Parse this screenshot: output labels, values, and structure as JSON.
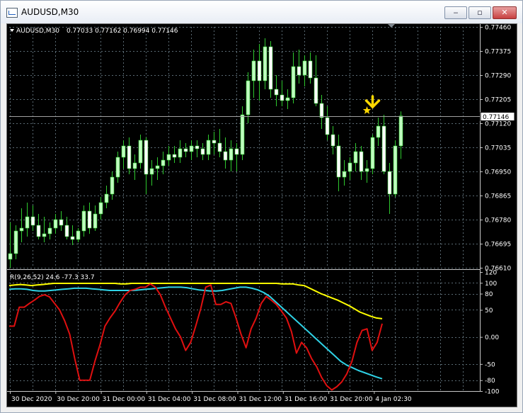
{
  "window": {
    "title": "AUDUSD,M30",
    "min_glyph": "‒",
    "max_glyph": "▫",
    "close_glyph": "✕"
  },
  "main": {
    "header_symbol": "AUDUSD,M30",
    "header_ohlc": "0.77033 0.77162 0.76994 0.77146",
    "current_price": "0.77146",
    "price_ticks": [
      "0.77460",
      "0.77375",
      "0.77290",
      "0.77205",
      "0.77120",
      "0.77035",
      "0.76950",
      "0.76865",
      "0.76780",
      "0.76695",
      "0.76610"
    ],
    "time_ticks": [
      "30 Dec 2020",
      "30 Dec 20:00",
      "31 Dec 00:00",
      "31 Dec 04:00",
      "31 Dec 08:00",
      "31 Dec 12:00",
      "31 Dec 16:00",
      "31 Dec 20:00",
      "4 Jan 02:30"
    ]
  },
  "indicator": {
    "label": "R(9,26,52) 24.6 -77.3 33.7",
    "ticks": [
      "120",
      "100",
      "80",
      "50",
      "0.00",
      "-50",
      "-80",
      "-100"
    ]
  },
  "colors": {
    "background": "#000000",
    "grid": "#5a6a73",
    "bull": "#bfffbf",
    "bear": "#ffffff",
    "wick": "#2ec82e",
    "line_yellow": "#ffff00",
    "line_cyan": "#2fd2e6",
    "line_red": "#e01010",
    "marker": "#ffd800"
  },
  "chart_data": {
    "type": "candlestick",
    "symbol": "AUDUSD",
    "timeframe": "M30",
    "price_range": [
      0.7661,
      0.7746
    ],
    "candles": [
      {
        "o": 0.7664,
        "h": 0.7677,
        "l": 0.7661,
        "c": 0.7666
      },
      {
        "o": 0.7666,
        "h": 0.7676,
        "l": 0.7664,
        "c": 0.7674
      },
      {
        "o": 0.7674,
        "h": 0.7682,
        "l": 0.767,
        "c": 0.7675
      },
      {
        "o": 0.7675,
        "h": 0.7684,
        "l": 0.7672,
        "c": 0.7679
      },
      {
        "o": 0.7679,
        "h": 0.7683,
        "l": 0.7674,
        "c": 0.7676
      },
      {
        "o": 0.7676,
        "h": 0.768,
        "l": 0.7671,
        "c": 0.7672
      },
      {
        "o": 0.7672,
        "h": 0.7679,
        "l": 0.767,
        "c": 0.7673
      },
      {
        "o": 0.7673,
        "h": 0.7677,
        "l": 0.7671,
        "c": 0.7675
      },
      {
        "o": 0.7675,
        "h": 0.768,
        "l": 0.7673,
        "c": 0.7678
      },
      {
        "o": 0.7678,
        "h": 0.7681,
        "l": 0.7674,
        "c": 0.7676
      },
      {
        "o": 0.7676,
        "h": 0.7679,
        "l": 0.7671,
        "c": 0.7672
      },
      {
        "o": 0.7672,
        "h": 0.7676,
        "l": 0.7669,
        "c": 0.7671
      },
      {
        "o": 0.7671,
        "h": 0.7675,
        "l": 0.767,
        "c": 0.7674
      },
      {
        "o": 0.7674,
        "h": 0.7683,
        "l": 0.7672,
        "c": 0.7681
      },
      {
        "o": 0.7681,
        "h": 0.7684,
        "l": 0.7673,
        "c": 0.7675
      },
      {
        "o": 0.7675,
        "h": 0.7683,
        "l": 0.7674,
        "c": 0.768
      },
      {
        "o": 0.768,
        "h": 0.7686,
        "l": 0.7678,
        "c": 0.7684
      },
      {
        "o": 0.7684,
        "h": 0.769,
        "l": 0.7682,
        "c": 0.7687
      },
      {
        "o": 0.7687,
        "h": 0.7695,
        "l": 0.7685,
        "c": 0.7693
      },
      {
        "o": 0.7693,
        "h": 0.7702,
        "l": 0.7691,
        "c": 0.77
      },
      {
        "o": 0.77,
        "h": 0.7706,
        "l": 0.7696,
        "c": 0.7704
      },
      {
        "o": 0.7704,
        "h": 0.7707,
        "l": 0.7694,
        "c": 0.7696
      },
      {
        "o": 0.7696,
        "h": 0.7701,
        "l": 0.7692,
        "c": 0.7698
      },
      {
        "o": 0.7698,
        "h": 0.7708,
        "l": 0.7696,
        "c": 0.7706
      },
      {
        "o": 0.7706,
        "h": 0.7707,
        "l": 0.7687,
        "c": 0.7694
      },
      {
        "o": 0.7694,
        "h": 0.7699,
        "l": 0.769,
        "c": 0.7696
      },
      {
        "o": 0.7696,
        "h": 0.77,
        "l": 0.7692,
        "c": 0.7697
      },
      {
        "o": 0.7697,
        "h": 0.7702,
        "l": 0.7694,
        "c": 0.7699
      },
      {
        "o": 0.7699,
        "h": 0.7704,
        "l": 0.7697,
        "c": 0.7701
      },
      {
        "o": 0.7701,
        "h": 0.7704,
        "l": 0.7698,
        "c": 0.77
      },
      {
        "o": 0.77,
        "h": 0.7706,
        "l": 0.7698,
        "c": 0.7703
      },
      {
        "o": 0.7703,
        "h": 0.7705,
        "l": 0.77,
        "c": 0.7702
      },
      {
        "o": 0.7702,
        "h": 0.7706,
        "l": 0.7699,
        "c": 0.7704
      },
      {
        "o": 0.7704,
        "h": 0.7706,
        "l": 0.77,
        "c": 0.7703
      },
      {
        "o": 0.7703,
        "h": 0.7705,
        "l": 0.7699,
        "c": 0.7701
      },
      {
        "o": 0.7701,
        "h": 0.7708,
        "l": 0.7699,
        "c": 0.7706
      },
      {
        "o": 0.7706,
        "h": 0.7709,
        "l": 0.7701,
        "c": 0.7705
      },
      {
        "o": 0.7705,
        "h": 0.771,
        "l": 0.77,
        "c": 0.7702
      },
      {
        "o": 0.7702,
        "h": 0.7707,
        "l": 0.7696,
        "c": 0.7699
      },
      {
        "o": 0.7699,
        "h": 0.7706,
        "l": 0.7695,
        "c": 0.7703
      },
      {
        "o": 0.7703,
        "h": 0.7705,
        "l": 0.7695,
        "c": 0.7701
      },
      {
        "o": 0.7701,
        "h": 0.7718,
        "l": 0.7699,
        "c": 0.7715
      },
      {
        "o": 0.7715,
        "h": 0.773,
        "l": 0.7712,
        "c": 0.7727
      },
      {
        "o": 0.7727,
        "h": 0.7738,
        "l": 0.7721,
        "c": 0.7734
      },
      {
        "o": 0.7734,
        "h": 0.774,
        "l": 0.772,
        "c": 0.7727
      },
      {
        "o": 0.7727,
        "h": 0.7742,
        "l": 0.7724,
        "c": 0.7739
      },
      {
        "o": 0.7739,
        "h": 0.7741,
        "l": 0.7721,
        "c": 0.7724
      },
      {
        "o": 0.7724,
        "h": 0.7729,
        "l": 0.7718,
        "c": 0.7722
      },
      {
        "o": 0.7722,
        "h": 0.7727,
        "l": 0.7718,
        "c": 0.772
      },
      {
        "o": 0.772,
        "h": 0.7724,
        "l": 0.7717,
        "c": 0.7721
      },
      {
        "o": 0.7721,
        "h": 0.7737,
        "l": 0.7719,
        "c": 0.7732
      },
      {
        "o": 0.7732,
        "h": 0.7738,
        "l": 0.7726,
        "c": 0.7729
      },
      {
        "o": 0.7729,
        "h": 0.7736,
        "l": 0.7725,
        "c": 0.7734
      },
      {
        "o": 0.7734,
        "h": 0.7737,
        "l": 0.7726,
        "c": 0.7728
      },
      {
        "o": 0.7728,
        "h": 0.7736,
        "l": 0.7718,
        "c": 0.7719
      },
      {
        "o": 0.7719,
        "h": 0.7722,
        "l": 0.771,
        "c": 0.7714
      },
      {
        "o": 0.7714,
        "h": 0.7718,
        "l": 0.7706,
        "c": 0.7708
      },
      {
        "o": 0.7708,
        "h": 0.7711,
        "l": 0.7701,
        "c": 0.7704
      },
      {
        "o": 0.7704,
        "h": 0.7708,
        "l": 0.7688,
        "c": 0.7693
      },
      {
        "o": 0.7693,
        "h": 0.7699,
        "l": 0.769,
        "c": 0.7695
      },
      {
        "o": 0.7695,
        "h": 0.77,
        "l": 0.7692,
        "c": 0.7698
      },
      {
        "o": 0.7698,
        "h": 0.7705,
        "l": 0.7695,
        "c": 0.7702
      },
      {
        "o": 0.7702,
        "h": 0.7704,
        "l": 0.7692,
        "c": 0.7695
      },
      {
        "o": 0.7695,
        "h": 0.7699,
        "l": 0.7691,
        "c": 0.7696
      },
      {
        "o": 0.7696,
        "h": 0.7708,
        "l": 0.7694,
        "c": 0.7707
      },
      {
        "o": 0.7707,
        "h": 0.7714,
        "l": 0.7704,
        "c": 0.7711
      },
      {
        "o": 0.7711,
        "h": 0.7715,
        "l": 0.7694,
        "c": 0.7695
      },
      {
        "o": 0.7695,
        "h": 0.7698,
        "l": 0.768,
        "c": 0.7687
      },
      {
        "o": 0.7687,
        "h": 0.7706,
        "l": 0.7686,
        "c": 0.7704
      },
      {
        "o": 0.7704,
        "h": 0.77162,
        "l": 0.76994,
        "c": 0.77146
      }
    ],
    "indicator": {
      "name": "R(9,26,52)",
      "values": [
        24.6,
        -77.3,
        33.7
      ],
      "range": [
        -100,
        120
      ],
      "yellow": [
        95,
        96,
        97,
        96,
        95,
        96,
        97,
        98,
        99,
        99,
        99,
        99,
        99,
        99,
        99,
        99,
        99,
        99,
        99,
        99,
        98,
        98,
        99,
        99,
        99,
        99,
        99,
        99,
        99,
        99,
        99,
        99,
        99,
        99,
        99,
        99,
        99,
        99,
        99,
        99,
        99,
        99,
        99,
        99,
        99,
        99,
        99,
        99,
        99,
        98,
        98,
        98,
        96,
        95,
        90,
        85,
        80,
        76,
        72,
        68,
        63,
        58,
        52,
        46,
        42,
        38,
        35,
        33.7
      ],
      "cyan": [
        88,
        89,
        89,
        88,
        86,
        85,
        85,
        86,
        87,
        88,
        89,
        90,
        90,
        90,
        89,
        88,
        87,
        86,
        86,
        86,
        86,
        86,
        87,
        88,
        89,
        90,
        91,
        92,
        92,
        92,
        91,
        89,
        87,
        86,
        85,
        85,
        86,
        88,
        90,
        92,
        92,
        90,
        87,
        82,
        75,
        65,
        55,
        45,
        35,
        25,
        15,
        5,
        -5,
        -15,
        -25,
        -35,
        -45,
        -52,
        -57,
        -62,
        -66,
        -70,
        -74,
        -77.3
      ],
      "red": [
        20,
        20,
        55,
        55,
        62,
        68,
        75,
        78,
        74,
        62,
        50,
        30,
        5,
        -40,
        -80,
        -80,
        -80,
        -45,
        -15,
        20,
        35,
        48,
        64,
        78,
        86,
        88,
        92,
        92,
        98,
        92,
        78,
        55,
        35,
        15,
        0,
        -25,
        -10,
        20,
        52,
        92,
        96,
        60,
        60,
        65,
        62,
        35,
        5,
        -20,
        15,
        35,
        62,
        75,
        68,
        60,
        48,
        35,
        10,
        -30,
        -10,
        -20,
        -40,
        -55,
        -75,
        -90,
        -98,
        -92,
        -83,
        -68,
        -45,
        -10,
        12,
        15,
        -25,
        -10,
        24.6
      ]
    }
  }
}
